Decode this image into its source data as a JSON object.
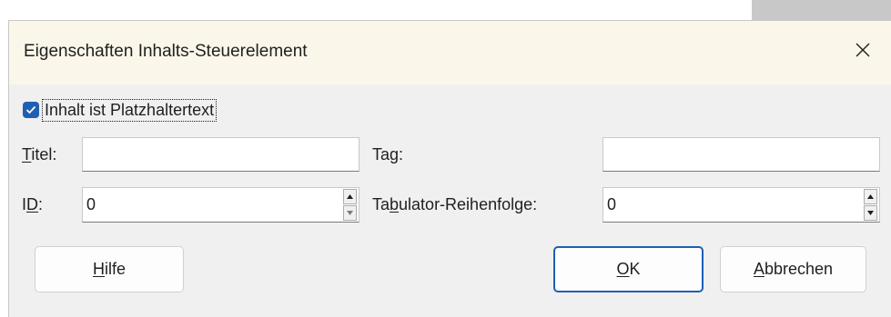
{
  "dialog": {
    "title": "Eigenschaften Inhalts-Steuerelement",
    "close_icon": "close-icon"
  },
  "placeholder_checkbox": {
    "checked": true,
    "label": "Inhalt ist Platzhaltertext"
  },
  "fields": {
    "title": {
      "label_accel": "T",
      "label_rest": "itel:",
      "value": ""
    },
    "tag": {
      "label_pre": "Ta",
      "label_accel": "g",
      "label_rest": ":",
      "value": ""
    },
    "id": {
      "label_pre": "I",
      "label_accel": "D",
      "label_rest": ":",
      "value": "0"
    },
    "tab_order": {
      "label_pre": "Ta",
      "label_accel": "b",
      "label_rest": "ulator-Reihenfolge:",
      "value": "0"
    }
  },
  "buttons": {
    "help": {
      "accel": "H",
      "rest": "ilfe"
    },
    "ok": {
      "accel": "O",
      "rest": "K"
    },
    "cancel": {
      "accel": "A",
      "rest": "bbrechen"
    }
  },
  "colors": {
    "accent": "#1e5fb3",
    "titlebar_bg": "#faf7ea",
    "dialog_bg": "#f0f0f0"
  }
}
